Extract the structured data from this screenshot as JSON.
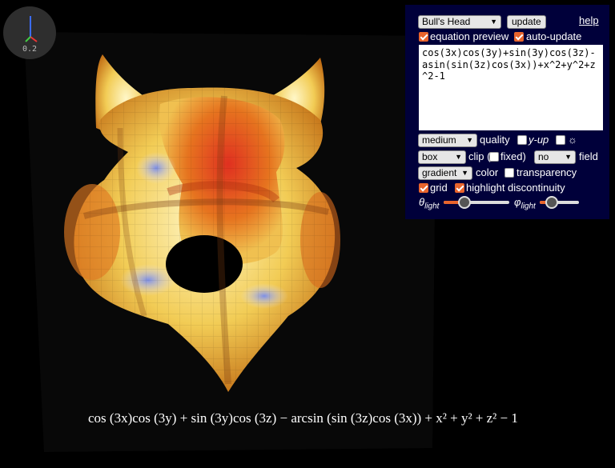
{
  "viewer": {
    "zoom_label": "0.2",
    "formula_rendered": "cos (3x)cos (3y) + sin (3y)cos (3z) − arcsin (sin (3z)cos (3x)) + x² + y² + z² − 1",
    "surface_icon": "3d-surface-render"
  },
  "panel": {
    "preset": "Bull's Head",
    "update_label": "update",
    "help_label": "help",
    "equation_preview_label": "equation preview",
    "equation_preview_checked": true,
    "auto_update_label": "auto-update",
    "auto_update_checked": true,
    "equation": "cos(3x)cos(3y)+sin(3y)cos(3z)-asin(sin(3z)cos(3x))+x^2+y^2+z^2-1",
    "quality_value": "medium",
    "quality_label": "quality",
    "y_up_label": "y-up",
    "y_up_checked": false,
    "light_label": "☼",
    "light_checked": false,
    "clip_value": "box",
    "clip_label": "clip (",
    "fixed_label": "fixed)",
    "fixed_checked": false,
    "field_value": "no",
    "field_label": "field",
    "color_value": "gradient",
    "color_label": "color",
    "transparency_label": "transparency",
    "transparency_checked": false,
    "grid_label": "grid",
    "grid_checked": true,
    "discontinuity_label": "highlight discontinuity",
    "discontinuity_checked": true,
    "theta_label": "θ",
    "theta_sub": "light",
    "theta_value": 0.27,
    "phi_label": "φ",
    "phi_sub": "light",
    "phi_value": 0.2
  },
  "colors": {
    "panel_bg": "#00003a",
    "accent": "#e8642c"
  }
}
